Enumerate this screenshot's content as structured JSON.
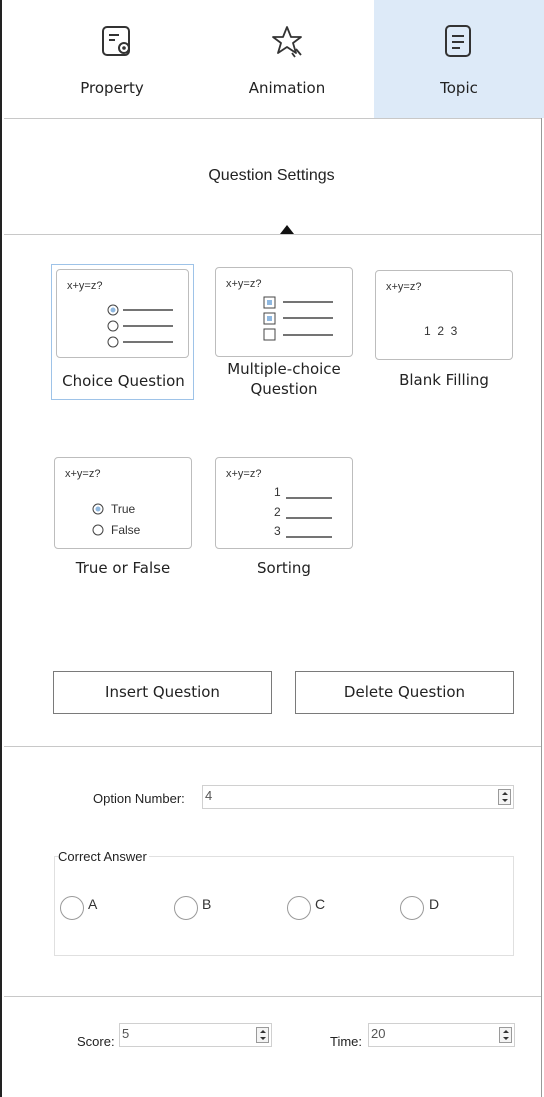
{
  "tabs": [
    {
      "label": "Property",
      "icon": "property-gear-icon",
      "active": false
    },
    {
      "label": "Animation",
      "icon": "star-icon",
      "active": false
    },
    {
      "label": "Topic",
      "icon": "document-icon",
      "active": true
    }
  ],
  "section_title": "Question Settings",
  "question_types": [
    {
      "label": "Choice Question",
      "preview_question": "x+y=z?",
      "selected": true
    },
    {
      "label": "Multiple-choice Question",
      "preview_question": "x+y=z?",
      "selected": false
    },
    {
      "label": "Blank Filling",
      "preview_question": "x+y=z?",
      "preview_blanks": "1  2  3",
      "selected": false
    },
    {
      "label": "True or False",
      "preview_question": "x+y=z?",
      "preview_true": "True",
      "preview_false": "False",
      "selected": false
    },
    {
      "label": "Sorting",
      "preview_question": "x+y=z?",
      "preview_items": [
        "1",
        "2",
        "3"
      ],
      "selected": false
    }
  ],
  "buttons": {
    "insert": "Insert Question",
    "delete": "Delete Question"
  },
  "option_number": {
    "label": "Option Number:",
    "value": "4"
  },
  "correct_answer": {
    "label": "Correct Answer",
    "options": [
      "A",
      "B",
      "C",
      "D"
    ]
  },
  "score": {
    "label": "Score:",
    "value": "5"
  },
  "time": {
    "label": "Time:",
    "value": "20"
  },
  "colors": {
    "active_tab": "#ddeaf8",
    "selected_border": "#9ec3e8",
    "radio_fill": "#8fb8e0"
  }
}
